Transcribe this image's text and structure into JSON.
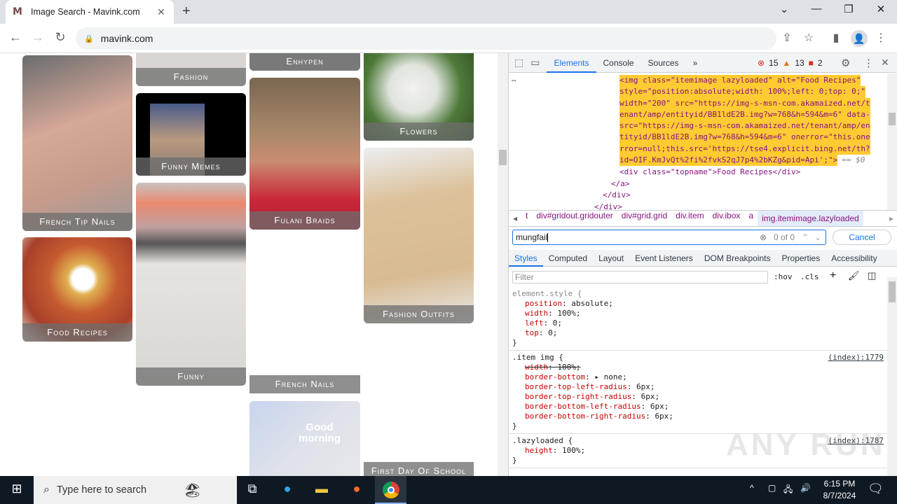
{
  "browser": {
    "tab_title": "Image Search - Mavink.com",
    "tab_favicon": "M",
    "url": "mavink.com"
  },
  "page": {
    "cards": [
      {
        "label": "French Tip Nails",
        "color": "#b8958a"
      },
      {
        "label": "Fashion",
        "color": "#c9c6c3"
      },
      {
        "label": "Enhypen",
        "color": "#8d8d8d"
      },
      {
        "label": "Flowers",
        "color": "#5f7e4a"
      },
      {
        "label": "Funny Memes",
        "color": "#0a0a0a"
      },
      {
        "label": "Fulani Braids",
        "color": "#8b6e5a"
      },
      {
        "label": "Food Recipes",
        "color": "#c86a3a"
      },
      {
        "label": "Funny",
        "color": "#d9d5d2"
      },
      {
        "label": "Fashion Outfits",
        "color": "#e3cfae"
      },
      {
        "label": "French Nails",
        "color": "#ffffff"
      },
      {
        "label": "Good morning",
        "color": "#d8dde8"
      },
      {
        "label": "First Day Of School",
        "color": "#ffffff"
      }
    ]
  },
  "devtools": {
    "tabs": [
      "Elements",
      "Console",
      "Sources"
    ],
    "more": "»",
    "errors": "15",
    "warnings": "13",
    "issues": "2",
    "code_lines": [
      "<img class=\"itemimage lazyloaded\" alt=\"Food Recipes\"",
      "style=\"position:absolute;width: 100%;left: 0;top: 0;\"",
      "width=\"200\" src=\"https://img-s-msn-com.akamaized.net/t",
      "enant/amp/entityid/BB1ldE2B.img?w=768&h=594&m=6\" data-",
      "src=\"https://img-s-msn-com.akamaized.net/tenant/amp/en",
      "tityid/BB1ldE2B.img?w=768&h=594&m=6\" onerror=\"this.one",
      "rror=null;this.src='https://tse4.explicit.bing.net/th?",
      "id=OIF.KmJvQt%2fi%2fvkS2qJ7p4%2bKZg&pid=Api';\">"
    ],
    "selected_marker": "== $0",
    "topname_line": "<div class=\"topname\">Food Recipes</div>",
    "close_a": "</a>",
    "close_div": "</div>",
    "close_div2": "</div>",
    "breadcrumbs": [
      "t",
      "div#gridout.gridouter",
      "div#grid.grid",
      "div.item",
      "div.ibox",
      "a",
      "img.itemimage.lazyloaded"
    ],
    "search_value": "mungfail",
    "search_count": "0 of 0",
    "cancel_label": "Cancel",
    "style_tabs": [
      "Styles",
      "Computed",
      "Layout",
      "Event Listeners",
      "DOM Breakpoints",
      "Properties",
      "Accessibility"
    ],
    "filter_placeholder": "Filter",
    "hov": ":hov",
    "cls": ".cls",
    "rules": [
      {
        "selector": "element.style {",
        "source": "",
        "props": [
          [
            "position",
            "absolute;",
            false
          ],
          [
            "width",
            "100%;",
            false
          ],
          [
            "left",
            "0;",
            false
          ],
          [
            "top",
            "0;",
            false
          ]
        ]
      },
      {
        "selector": ".item img {",
        "source": "(index):1779",
        "props": [
          [
            "width",
            "100%;",
            true
          ],
          [
            "border-bottom",
            "▸ none;",
            false
          ],
          [
            "border-top-left-radius",
            "6px;",
            false
          ],
          [
            "border-top-right-radius",
            "6px;",
            false
          ],
          [
            "border-bottom-left-radius",
            "6px;",
            false
          ],
          [
            "border-bottom-right-radius",
            "6px;",
            false
          ]
        ]
      },
      {
        "selector": ".lazyloaded {",
        "source": "(index):1787",
        "props": [
          [
            "height",
            "100%;",
            false
          ]
        ]
      }
    ]
  },
  "taskbar": {
    "search_placeholder": "Type here to search",
    "time": "6:15 PM",
    "date": "8/7/2024"
  },
  "watermark": "ANY RUN"
}
